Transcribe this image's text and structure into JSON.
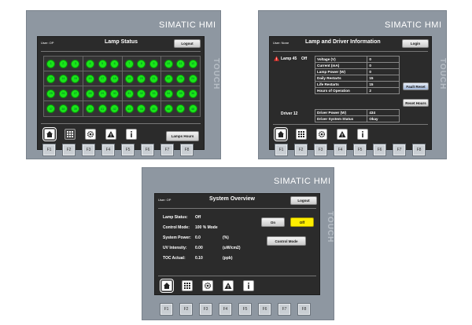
{
  "common": {
    "brand": "SIMATIC HMI",
    "touch": "TOUCH",
    "fkeys": [
      "F1",
      "F2",
      "F3",
      "F4",
      "F5",
      "F6",
      "F7",
      "F8"
    ]
  },
  "panel1": {
    "user": "User: OP",
    "title": "Lamp Status",
    "logout": "Logout",
    "lamps_hours": "Lamps Hours",
    "lamp_rows": [
      [
        "1",
        "2",
        "3",
        "4",
        "5",
        "6",
        "7",
        "8",
        "9",
        "10",
        "11",
        "12"
      ],
      [
        "13",
        "14",
        "15",
        "16",
        "17",
        "18",
        "19",
        "20",
        "21",
        "22",
        "23",
        "24"
      ],
      [
        "25",
        "26",
        "27",
        "28",
        "29",
        "30",
        "31",
        "32",
        "33",
        "34",
        "35",
        "36"
      ],
      [
        "37",
        "38",
        "39",
        "40",
        "41",
        "42",
        "43",
        "44",
        "45",
        "46",
        "47",
        "48"
      ]
    ],
    "lamp_color": "#19e619"
  },
  "panel2": {
    "user": "User: None",
    "title": "Lamp and Driver Information",
    "login": "Login",
    "lamp_label": "Lamp 45",
    "lamp_state": "Off",
    "driver_label": "Driver 12",
    "lamp_table": [
      {
        "k": "Voltage (V)",
        "v": "0"
      },
      {
        "k": "Current (mA)",
        "v": "0"
      },
      {
        "k": "Lamp Power (W)",
        "v": "0"
      },
      {
        "k": "Daily Restarts",
        "v": "15"
      },
      {
        "k": "Life Restarts",
        "v": "15"
      },
      {
        "k": "Hours of Operation",
        "v": "2"
      }
    ],
    "driver_table": [
      {
        "k": "Driver Power (W)",
        "v": "434"
      },
      {
        "k": "Driver System Status",
        "v": "Okay"
      }
    ],
    "fault_reset": "Fault Reset",
    "reset_hours": "Reset Hours"
  },
  "panel3": {
    "user": "User: OP",
    "title": "System Overview",
    "logout": "Logout",
    "rows": [
      {
        "label": "Lamp Status:",
        "value": "Off",
        "unit": ""
      },
      {
        "label": "Control Mode:",
        "value": "100 % Mode",
        "unit": ""
      },
      {
        "label": "System Power:",
        "value": "0.0",
        "unit": "(%)"
      },
      {
        "label": "UV Intensity:",
        "value": "0.00",
        "unit": "(uW/cm2)"
      },
      {
        "label": "TOC Actual:",
        "value": "0.10",
        "unit": "(ppb)"
      }
    ],
    "on_label": "On",
    "off_label": "Off",
    "control_mode_button": "Control Mode",
    "off_color": "#ffee00"
  }
}
